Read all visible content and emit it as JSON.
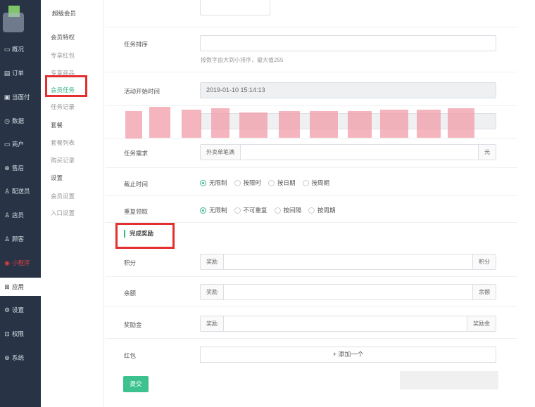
{
  "sidebar": {
    "items": [
      {
        "icon": "▭",
        "icon_name": "overview-icon",
        "label": "概况"
      },
      {
        "icon": "▤",
        "icon_name": "order-icon",
        "label": "订单"
      },
      {
        "icon": "▣",
        "icon_name": "pay-icon",
        "label": "当面付"
      },
      {
        "icon": "◷",
        "icon_name": "data-icon",
        "label": "数据"
      },
      {
        "icon": "▭",
        "icon_name": "merchant-icon",
        "label": "商户"
      },
      {
        "icon": "⊕",
        "icon_name": "aftersale-icon",
        "label": "售后"
      },
      {
        "icon": "♙",
        "icon_name": "delivery-icon",
        "label": "配送员"
      },
      {
        "icon": "♙",
        "icon_name": "clerk-icon",
        "label": "店员"
      },
      {
        "icon": "♙",
        "icon_name": "customer-icon",
        "label": "顾客"
      },
      {
        "icon": "◉",
        "icon_name": "miniprogram-icon",
        "label": "小程序"
      },
      {
        "icon": "⊞",
        "icon_name": "apps-icon",
        "label": "应用"
      },
      {
        "icon": "⚙",
        "icon_name": "settings-icon",
        "label": "设置"
      },
      {
        "icon": "⊡",
        "icon_name": "permission-icon",
        "label": "权限"
      },
      {
        "icon": "⊛",
        "icon_name": "system-icon",
        "label": "系统"
      }
    ]
  },
  "submenu": {
    "title": "超级会员",
    "group1": "会员特权",
    "item_redpacket": "专享红包",
    "item_goods": "专享商品",
    "item_task": "会员任务",
    "item_task_record": "任务记录",
    "group2": "套餐",
    "item_package_list": "套餐列表",
    "item_purchase_record": "购买记录",
    "group3": "设置",
    "item_member_settings": "会员设置",
    "item_entry_settings": "入口设置"
  },
  "form": {
    "sort_label": "任务排序",
    "sort_hint": "按数字由大到小排序，最大值255",
    "start_label": "活动开始时间",
    "start_value": "2019-01-10 15:14:13",
    "req_label": "任务需求",
    "req_prefix": "外卖单笔满",
    "req_suffix": "元",
    "deadline_label": "截止时间",
    "deadline_options": [
      "无限制",
      "按限时",
      "按日期",
      "按周期"
    ],
    "repeat_label": "重复领取",
    "repeat_options": [
      "无限制",
      "不可重复",
      "按间隔",
      "按周期"
    ],
    "reward_section": "完成奖励",
    "points_label": "积分",
    "points_prefix": "奖励",
    "points_suffix": "积分",
    "balance_label": "余额",
    "balance_prefix": "奖励",
    "balance_suffix": "余额",
    "bonus_label": "奖励金",
    "bonus_prefix": "奖励",
    "bonus_suffix": "奖励金",
    "redpacket_label": "红包",
    "add_button": "+ 添加一个",
    "submit": "提交"
  },
  "colors": {
    "sidebar_bg": "#283445",
    "accent": "#39b58b",
    "highlight_box": "#e32f2f"
  }
}
